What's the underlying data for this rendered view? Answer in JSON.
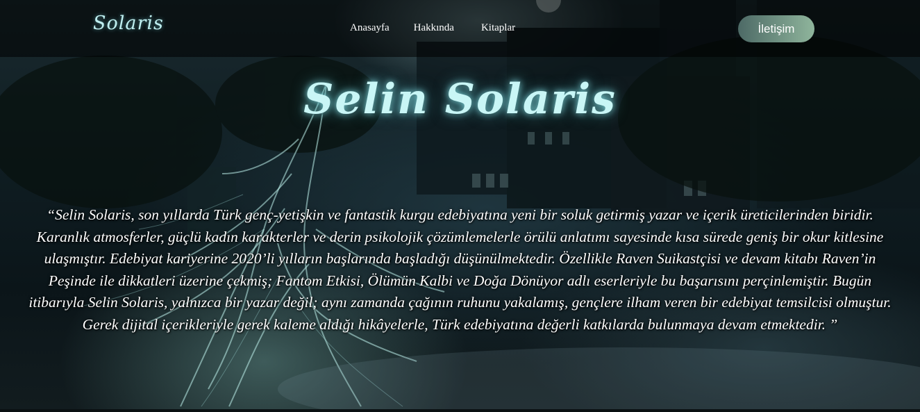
{
  "site": {
    "logo": "Solaris"
  },
  "nav": {
    "items": [
      {
        "label": "Anasayfa"
      },
      {
        "label": "Hakkında"
      },
      {
        "label": "Kitaplar"
      }
    ],
    "contact_label": "İletişim"
  },
  "hero": {
    "title": "Selin Solaris",
    "bio": "“Selin Solaris, son yıllarda Türk genç-yetişkin ve fantastik kurgu edebiyatına yeni bir soluk getirmiş yazar ve içerik üreticilerinden biridir. Karanlık atmosferler, güçlü kadın karakterler ve derin psikolojik çözümlemelerle örülü anlatımı sayesinde kısa sürede geniş bir okur kitlesine ulaşmıştır. Edebiyat kariyerine 2020’li yılların başlarında başladığı düşünülmektedir. Özellikle Raven Suikastçisi ve devam kitabı Raven’in Peşinde ile dikkatleri üzerine çekmiş; Fantom Etkisi, Ölümün Kalbi ve Doğa Dönüyor adlı eserleriyle bu başarısını perçinlemiştir. Bugün itibarıyla Selin Solaris, yalnızca bir yazar değil; aynı zamanda çağının ruhunu yakalamış, gençlere ilham veren bir edebiyat temsilcisi olmuştur. Gerek dijital içerikleriyle gerek kaleme aldığı hikâyelerle, Türk edebiyatına değerli katkılarda bulunmaya devam etmektedir. ”"
  },
  "colors": {
    "accent": "#bfeff0",
    "button_start": "#4d6a66",
    "button_end": "#8fb59c"
  }
}
